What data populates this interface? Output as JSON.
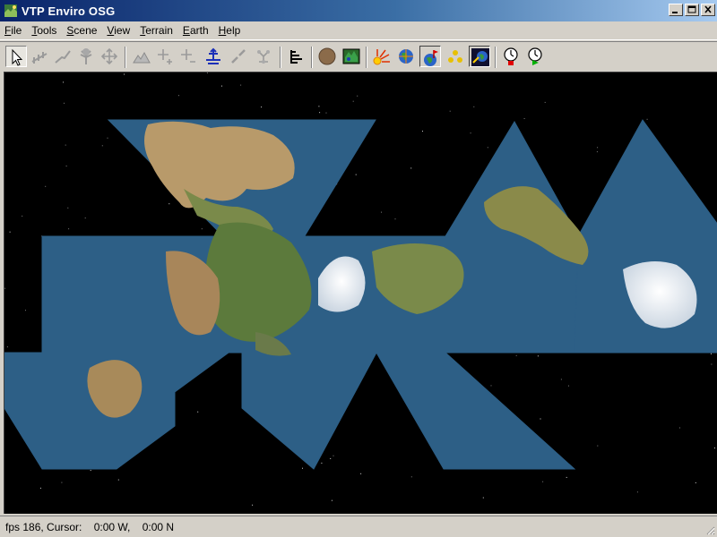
{
  "window": {
    "title": "VTP Enviro OSG"
  },
  "menu": [
    {
      "label": "File",
      "ul": "F",
      "rest": "ile"
    },
    {
      "label": "Tools",
      "ul": "T",
      "rest": "ools"
    },
    {
      "label": "Scene",
      "ul": "S",
      "rest": "cene"
    },
    {
      "label": "View",
      "ul": "V",
      "rest": "iew"
    },
    {
      "label": "Terrain",
      "ul": "T",
      "rest": "errain"
    },
    {
      "label": "Earth",
      "ul": "E",
      "rest": "arth"
    },
    {
      "label": "Help",
      "ul": "H",
      "rest": "elp"
    }
  ],
  "toolbar": {
    "icons": [
      "select-arrow-icon",
      "fence-icon",
      "route-icon",
      "plant-icon",
      "move-icon",
      "terrain-icon",
      "pan-plus-icon",
      "pan-minus-icon",
      "anchor-icon",
      "link-icon",
      "nodes-icon",
      "layers-icon",
      "globe-flat-icon",
      "map-icon",
      "sun-icon",
      "globe-icon",
      "flag-globe-icon",
      "dots-icon",
      "spacenav-icon",
      "time-stop-icon",
      "time-go-icon"
    ]
  },
  "statusbar": {
    "text": "fps 186, Cursor:    0:00 W,    0:00 N"
  },
  "colors": {
    "titlebar_start": "#0a246a",
    "titlebar_end": "#a6caf0",
    "chrome": "#d4d0c8",
    "ocean": "#2e5a80"
  }
}
